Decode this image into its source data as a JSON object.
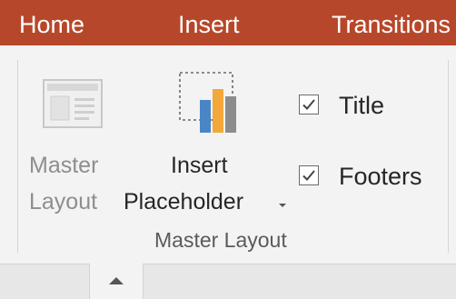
{
  "tabs": [
    {
      "label": "Home"
    },
    {
      "label": "Insert"
    },
    {
      "label": "Transitions"
    }
  ],
  "master_layout_button": {
    "line1": "Master",
    "line2": "Layout",
    "icon": "master-layout-icon",
    "enabled": false
  },
  "insert_placeholder_button": {
    "line1": "Insert",
    "line2": "Placeholder",
    "icon": "insert-placeholder-icon",
    "has_dropdown": true
  },
  "checkboxes": [
    {
      "label": "Title",
      "checked": true
    },
    {
      "label": "Footers",
      "checked": true
    }
  ],
  "group_label": "Master Layout",
  "colors": {
    "tab_bar": "#b7472a",
    "ribbon_bg": "#f3f3f3",
    "chart_blue": "#4a86c5",
    "chart_orange": "#f2a83a",
    "chart_gray": "#8c8c8c"
  }
}
